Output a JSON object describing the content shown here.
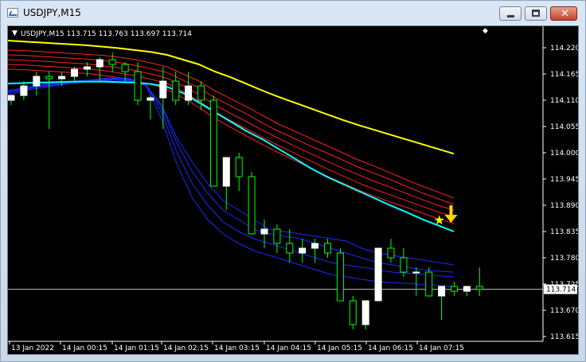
{
  "window": {
    "title": "USDJPY,M15",
    "close_glyph": "✕"
  },
  "chart": {
    "symbol_line": "USDJPY,M15 113.715 113.763 113.697 113.714",
    "current_price_label": "113.714",
    "colors": {
      "background": "#000000",
      "bull_body": "#ffffff",
      "bear_body": "#000000",
      "candle_outline": "#ffffff",
      "axis": "#ffffff",
      "ema_yellow": "#ffff00",
      "ema_cyan": "#00ffff",
      "red_band": "#ff2020",
      "blue_band": "#1a2bff",
      "marker_star": "#ffff00",
      "marker_arrow": "#ffd700"
    },
    "markers": [
      {
        "type": "star-icon",
        "candle_index": 34
      },
      {
        "type": "arrow-down-icon",
        "candle_index": 35
      }
    ]
  },
  "chart_data": {
    "type": "candlestick",
    "price_ticks": [
      "114.220",
      "114.165",
      "114.110",
      "114.055",
      "114.000",
      "113.945",
      "113.890",
      "113.835",
      "113.780",
      "113.725",
      "113.670",
      "113.615"
    ],
    "time_labels": [
      "13 Jan 2022",
      "14 Jan 00:15",
      "14 Jan 01:15",
      "14 Jan 02:15",
      "14 Jan 03:15",
      "14 Jan 04:15",
      "14 Jan 05:15",
      "14 Jan 06:15",
      "14 Jan 07:15"
    ],
    "candles": [
      [
        114.11,
        114.12,
        114.1,
        114.12
      ],
      [
        114.12,
        114.15,
        114.11,
        114.14
      ],
      [
        114.14,
        114.17,
        114.12,
        114.16
      ],
      [
        114.16,
        114.17,
        114.05,
        114.155
      ],
      [
        114.155,
        114.17,
        114.14,
        114.16
      ],
      [
        114.16,
        114.18,
        114.15,
        114.175
      ],
      [
        114.175,
        114.19,
        114.16,
        114.18
      ],
      [
        114.18,
        114.2,
        114.15,
        114.195
      ],
      [
        114.195,
        114.21,
        114.17,
        114.185
      ],
      [
        114.185,
        114.19,
        114.15,
        114.17
      ],
      [
        114.17,
        114.19,
        114.1,
        114.11
      ],
      [
        114.11,
        114.12,
        114.07,
        114.115
      ],
      [
        114.115,
        114.18,
        114.05,
        114.15
      ],
      [
        114.15,
        114.17,
        114.1,
        114.11
      ],
      [
        114.11,
        114.17,
        114.1,
        114.14
      ],
      [
        114.14,
        114.15,
        114.09,
        114.11
      ],
      [
        114.11,
        114.12,
        113.93,
        113.93
      ],
      [
        113.93,
        113.98,
        113.88,
        113.99
      ],
      [
        113.99,
        114.0,
        113.92,
        113.95
      ],
      [
        113.95,
        113.96,
        113.83,
        113.83
      ],
      [
        113.83,
        113.86,
        113.8,
        113.84
      ],
      [
        113.84,
        113.85,
        113.79,
        113.81
      ],
      [
        113.81,
        113.84,
        113.77,
        113.79
      ],
      [
        113.79,
        113.82,
        113.77,
        113.8
      ],
      [
        113.8,
        113.82,
        113.77,
        113.81
      ],
      [
        113.81,
        113.82,
        113.78,
        113.79
      ],
      [
        113.79,
        113.8,
        113.7,
        113.69
      ],
      [
        113.69,
        113.7,
        113.63,
        113.64
      ],
      [
        113.64,
        113.69,
        113.63,
        113.69
      ],
      [
        113.69,
        113.79,
        113.69,
        113.8
      ],
      [
        113.8,
        113.82,
        113.77,
        113.78
      ],
      [
        113.78,
        113.8,
        113.74,
        113.75
      ],
      [
        113.75,
        113.76,
        113.7,
        113.75
      ],
      [
        113.75,
        113.76,
        113.7,
        113.7
      ],
      [
        113.7,
        113.71,
        113.65,
        113.72
      ],
      [
        113.72,
        113.73,
        113.7,
        113.71
      ],
      [
        113.71,
        113.72,
        113.7,
        113.72
      ],
      [
        113.72,
        113.76,
        113.7,
        113.714
      ]
    ],
    "ema_yellow": [
      114.235,
      114.233,
      114.231,
      114.229,
      114.227,
      114.225,
      114.222,
      114.219,
      114.215,
      114.211,
      114.205,
      114.195,
      114.185,
      114.17,
      114.158,
      114.144,
      114.13,
      114.117,
      114.105,
      114.093,
      114.081,
      114.069,
      114.058,
      114.048,
      114.038,
      114.028,
      114.018,
      114.008,
      113.998
    ],
    "ema_cyan": [
      114.145,
      114.146,
      114.147,
      114.148,
      114.149,
      114.149,
      114.149,
      114.148,
      114.147,
      114.144,
      114.138,
      114.125,
      114.105,
      114.085,
      114.065,
      114.045,
      114.028,
      114.008,
      113.988,
      113.968,
      113.95,
      113.935,
      113.92,
      113.905,
      113.89,
      113.876,
      113.861,
      113.848,
      113.835
    ],
    "red_bands": [
      [
        114.215,
        114.214,
        114.212,
        114.21,
        114.208,
        114.206,
        114.204,
        114.2,
        114.195,
        114.188,
        114.18,
        114.165,
        114.15,
        114.13,
        114.113,
        114.096,
        114.078,
        114.06,
        114.045,
        114.03,
        114.015,
        114.0,
        113.985,
        113.972,
        113.958,
        113.944,
        113.93,
        113.918,
        113.905
      ],
      [
        114.205,
        114.204,
        114.202,
        114.2,
        114.198,
        114.196,
        114.193,
        114.189,
        114.183,
        114.176,
        114.168,
        114.152,
        114.136,
        114.115,
        114.098,
        114.081,
        114.062,
        114.045,
        114.03,
        114.014,
        114.0,
        113.985,
        113.97,
        113.957,
        113.944,
        113.93,
        113.916,
        113.904,
        113.892
      ],
      [
        114.195,
        114.194,
        114.192,
        114.19,
        114.188,
        114.186,
        114.182,
        114.178,
        114.172,
        114.165,
        114.156,
        114.14,
        114.122,
        114.1,
        114.082,
        114.065,
        114.047,
        114.03,
        114.014,
        113.998,
        113.983,
        113.968,
        113.954,
        113.94,
        113.928,
        113.915,
        113.902,
        113.89,
        113.88
      ],
      [
        114.185,
        114.184,
        114.182,
        114.18,
        114.178,
        114.176,
        114.172,
        114.167,
        114.161,
        114.154,
        114.145,
        114.128,
        114.108,
        114.086,
        114.067,
        114.05,
        114.032,
        114.015,
        113.999,
        113.983,
        113.967,
        113.952,
        113.937,
        113.924,
        113.912,
        113.9,
        113.888,
        113.876,
        113.866
      ],
      [
        114.175,
        114.174,
        114.172,
        114.17,
        114.168,
        114.166,
        114.162,
        114.157,
        114.15,
        114.143,
        114.133,
        114.115,
        114.095,
        114.072,
        114.053,
        114.035,
        114.017,
        114.0,
        113.984,
        113.968,
        113.952,
        113.937,
        113.922,
        113.909,
        113.897,
        113.886,
        113.874,
        113.862,
        113.852
      ]
    ],
    "blue_bands": [
      [
        114.12,
        114.13,
        114.135,
        114.14,
        114.145,
        114.148,
        114.15,
        114.152,
        114.15,
        114.14,
        114.1,
        114.03,
        113.98,
        113.935,
        113.9,
        113.88,
        113.86,
        113.84,
        113.835,
        113.83,
        113.825,
        113.82,
        113.815,
        113.8,
        113.79,
        113.785,
        113.78,
        113.775,
        113.77,
        113.765
      ],
      [
        114.125,
        114.132,
        114.138,
        114.142,
        114.146,
        114.149,
        114.152,
        114.154,
        114.152,
        114.142,
        114.095,
        114.02,
        113.96,
        113.915,
        113.88,
        113.86,
        113.84,
        113.83,
        113.825,
        113.82,
        113.81,
        113.8,
        113.79,
        113.78,
        113.77,
        113.765,
        113.76,
        113.755,
        113.752,
        113.75
      ],
      [
        114.128,
        114.134,
        114.14,
        114.144,
        114.147,
        114.15,
        114.153,
        114.156,
        114.154,
        114.142,
        114.085,
        114.0,
        113.935,
        113.89,
        113.855,
        113.835,
        113.82,
        113.81,
        113.8,
        113.79,
        113.78,
        113.77,
        113.765,
        113.76,
        113.755,
        113.75,
        113.748,
        113.745,
        113.742,
        113.74
      ],
      [
        114.13,
        114.136,
        114.142,
        114.146,
        114.149,
        114.152,
        114.155,
        114.158,
        114.155,
        114.14,
        114.07,
        113.975,
        113.905,
        113.86,
        113.83,
        113.81,
        113.795,
        113.785,
        113.775,
        113.765,
        113.755,
        113.745,
        113.74,
        113.735,
        113.73,
        113.728,
        113.726,
        113.724,
        113.722,
        113.72
      ]
    ],
    "ylim": [
      113.6,
      114.24
    ]
  }
}
